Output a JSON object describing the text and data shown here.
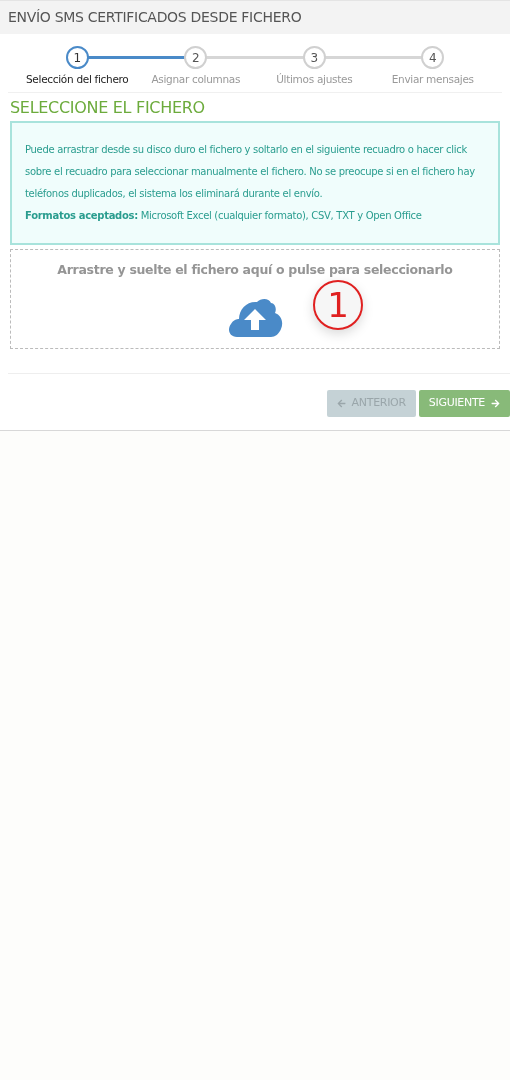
{
  "window": {
    "title": "ENVÍO SMS CERTIFICADOS DESDE FICHERO"
  },
  "steps": [
    {
      "number": "1",
      "label": "Selección del fichero",
      "selected": true
    },
    {
      "number": "2",
      "label": "Asignar columnas",
      "selected": false
    },
    {
      "number": "3",
      "label": "Últimos ajustes",
      "selected": false
    },
    {
      "number": "4",
      "label": "Enviar mensajes",
      "selected": false
    }
  ],
  "section": {
    "title": "SELECCIONE EL FICHERO"
  },
  "info": {
    "text": "Puede arrastrar desde su disco duro el fichero y soltarlo en el siguiente recuadro o hacer click sobre el recuadro para seleccionar manualmente el fichero. No se preocupe si en el fichero hay teléfonos duplicados, el sistema los eliminará durante el envío.",
    "formats": "**Formatos aceptados:** Microsoft Excel (cualquier formato), CSV, TXT y Open Office"
  },
  "dropzone": {
    "text": "Arrastre y suelte el fichero aquí o pulse para seleccionarlo",
    "marker": "1"
  },
  "buttons": [
    {
      "kind": "back",
      "label": "ANTERIOR",
      "disabled": true
    },
    {
      "kind": "next",
      "label": "SIGUIENTE",
      "disabled": false
    }
  ]
}
